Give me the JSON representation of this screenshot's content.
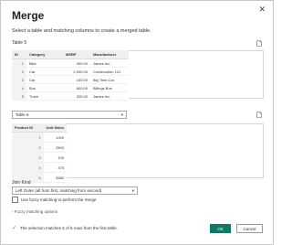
{
  "dialog": {
    "title": "Merge",
    "close_glyph": "✕",
    "subtitle": "Select a table and matching columns to create a merged table."
  },
  "table1": {
    "name": "Table 5",
    "columns": [
      "ID",
      "Category",
      "MSRP",
      "Manufacturer"
    ],
    "rows": [
      [
        "1",
        "Bike",
        "300.00",
        "James Inc."
      ],
      [
        "2",
        "Car",
        "2,000.00",
        "Construction 101"
      ],
      [
        "3",
        "Car",
        "150.00",
        "Big Time Car"
      ],
      [
        "4",
        "Bus",
        "600.00",
        "Billings Bus"
      ],
      [
        "5",
        "Truck",
        "325.00",
        "James Inc."
      ]
    ]
  },
  "table2": {
    "selected": "Table 6",
    "columns": [
      "Product ID",
      "Unit Sales"
    ],
    "rows": [
      [
        "1",
        "1000"
      ],
      [
        "2",
        "2500"
      ],
      [
        "3",
        "100"
      ],
      [
        "4",
        "375"
      ],
      [
        "5",
        "4580"
      ]
    ]
  },
  "join": {
    "label": "Join Kind",
    "selected": "Left Outer (all from first, matching from second)",
    "fuzzy_checkbox_label": "Use fuzzy matching to perform the merge",
    "fuzzy_options_label": "Fuzzy matching options"
  },
  "status": {
    "text": "The selection matches 5 of 6 rows from the first table."
  },
  "buttons": {
    "ok": "OK",
    "cancel": "Cancel"
  },
  "colors": {
    "accent": "#117865",
    "success": "#2e8b57"
  },
  "icons": {
    "table1": "document-icon",
    "table2": "document-icon",
    "chevron": "chevron-down-icon"
  }
}
